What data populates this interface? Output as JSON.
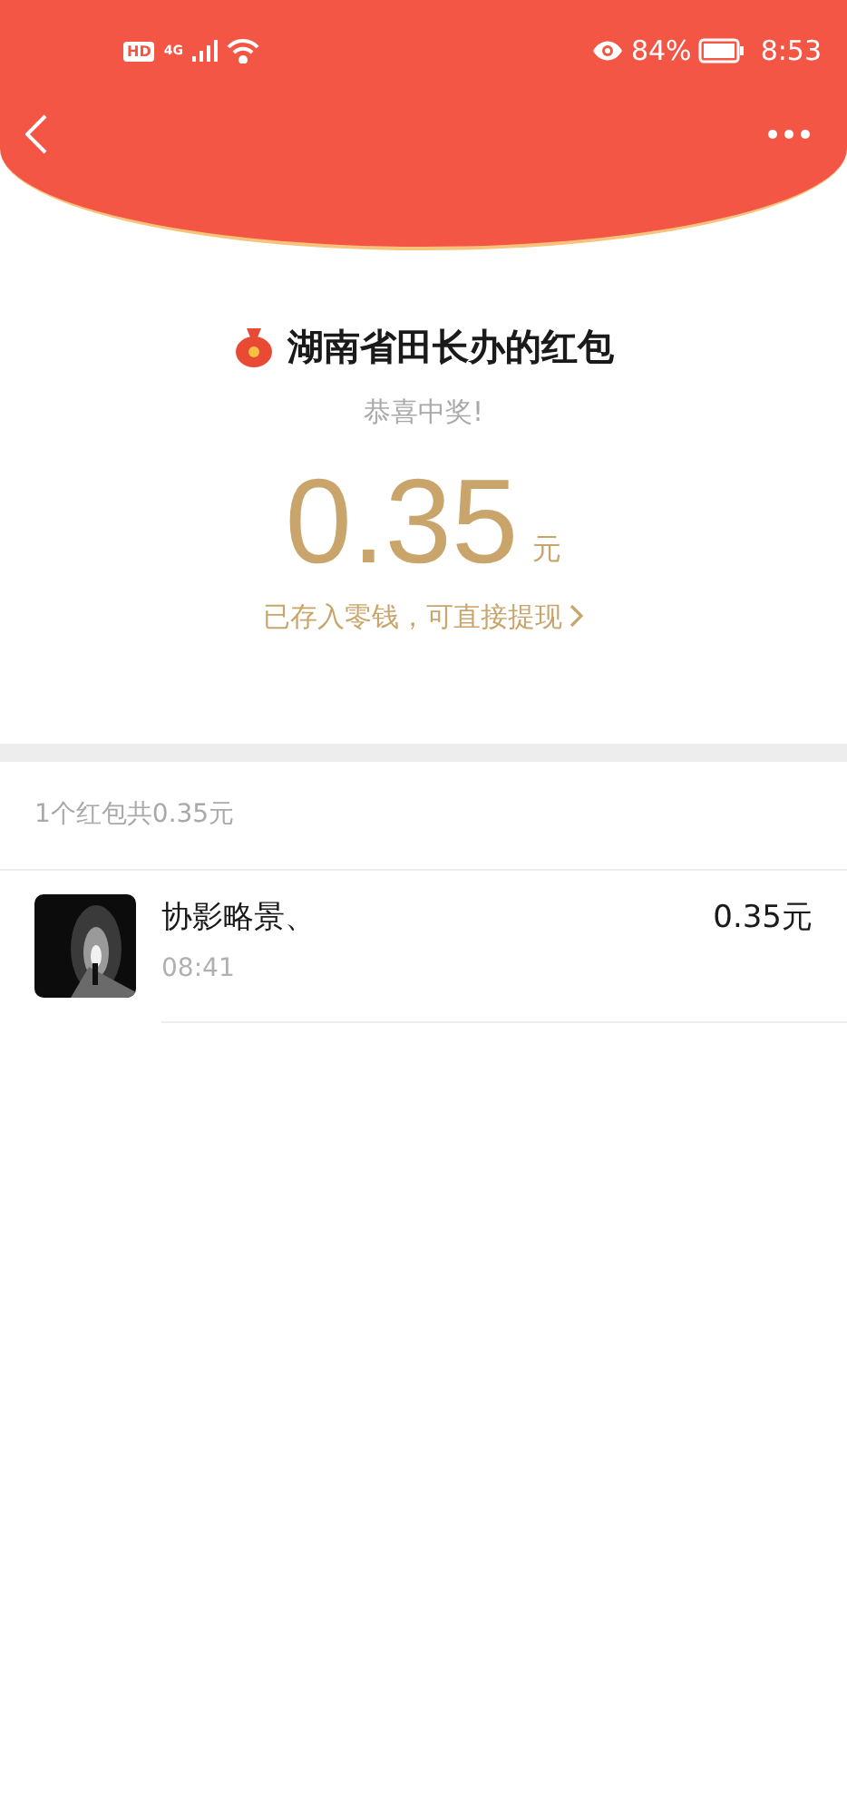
{
  "status_bar": {
    "hd": "HD",
    "network": "4G",
    "battery": "84%",
    "time": "8:53"
  },
  "packet": {
    "title": "湖南省田长办的红包",
    "greeting": "恭喜中奖!",
    "amount": "0.35",
    "unit": "元",
    "link": "已存入零钱，可直接提现"
  },
  "summary": "1个红包共0.35元",
  "records": [
    {
      "name": "协影略景、",
      "time": "08:41",
      "amount": "0.35元"
    }
  ]
}
